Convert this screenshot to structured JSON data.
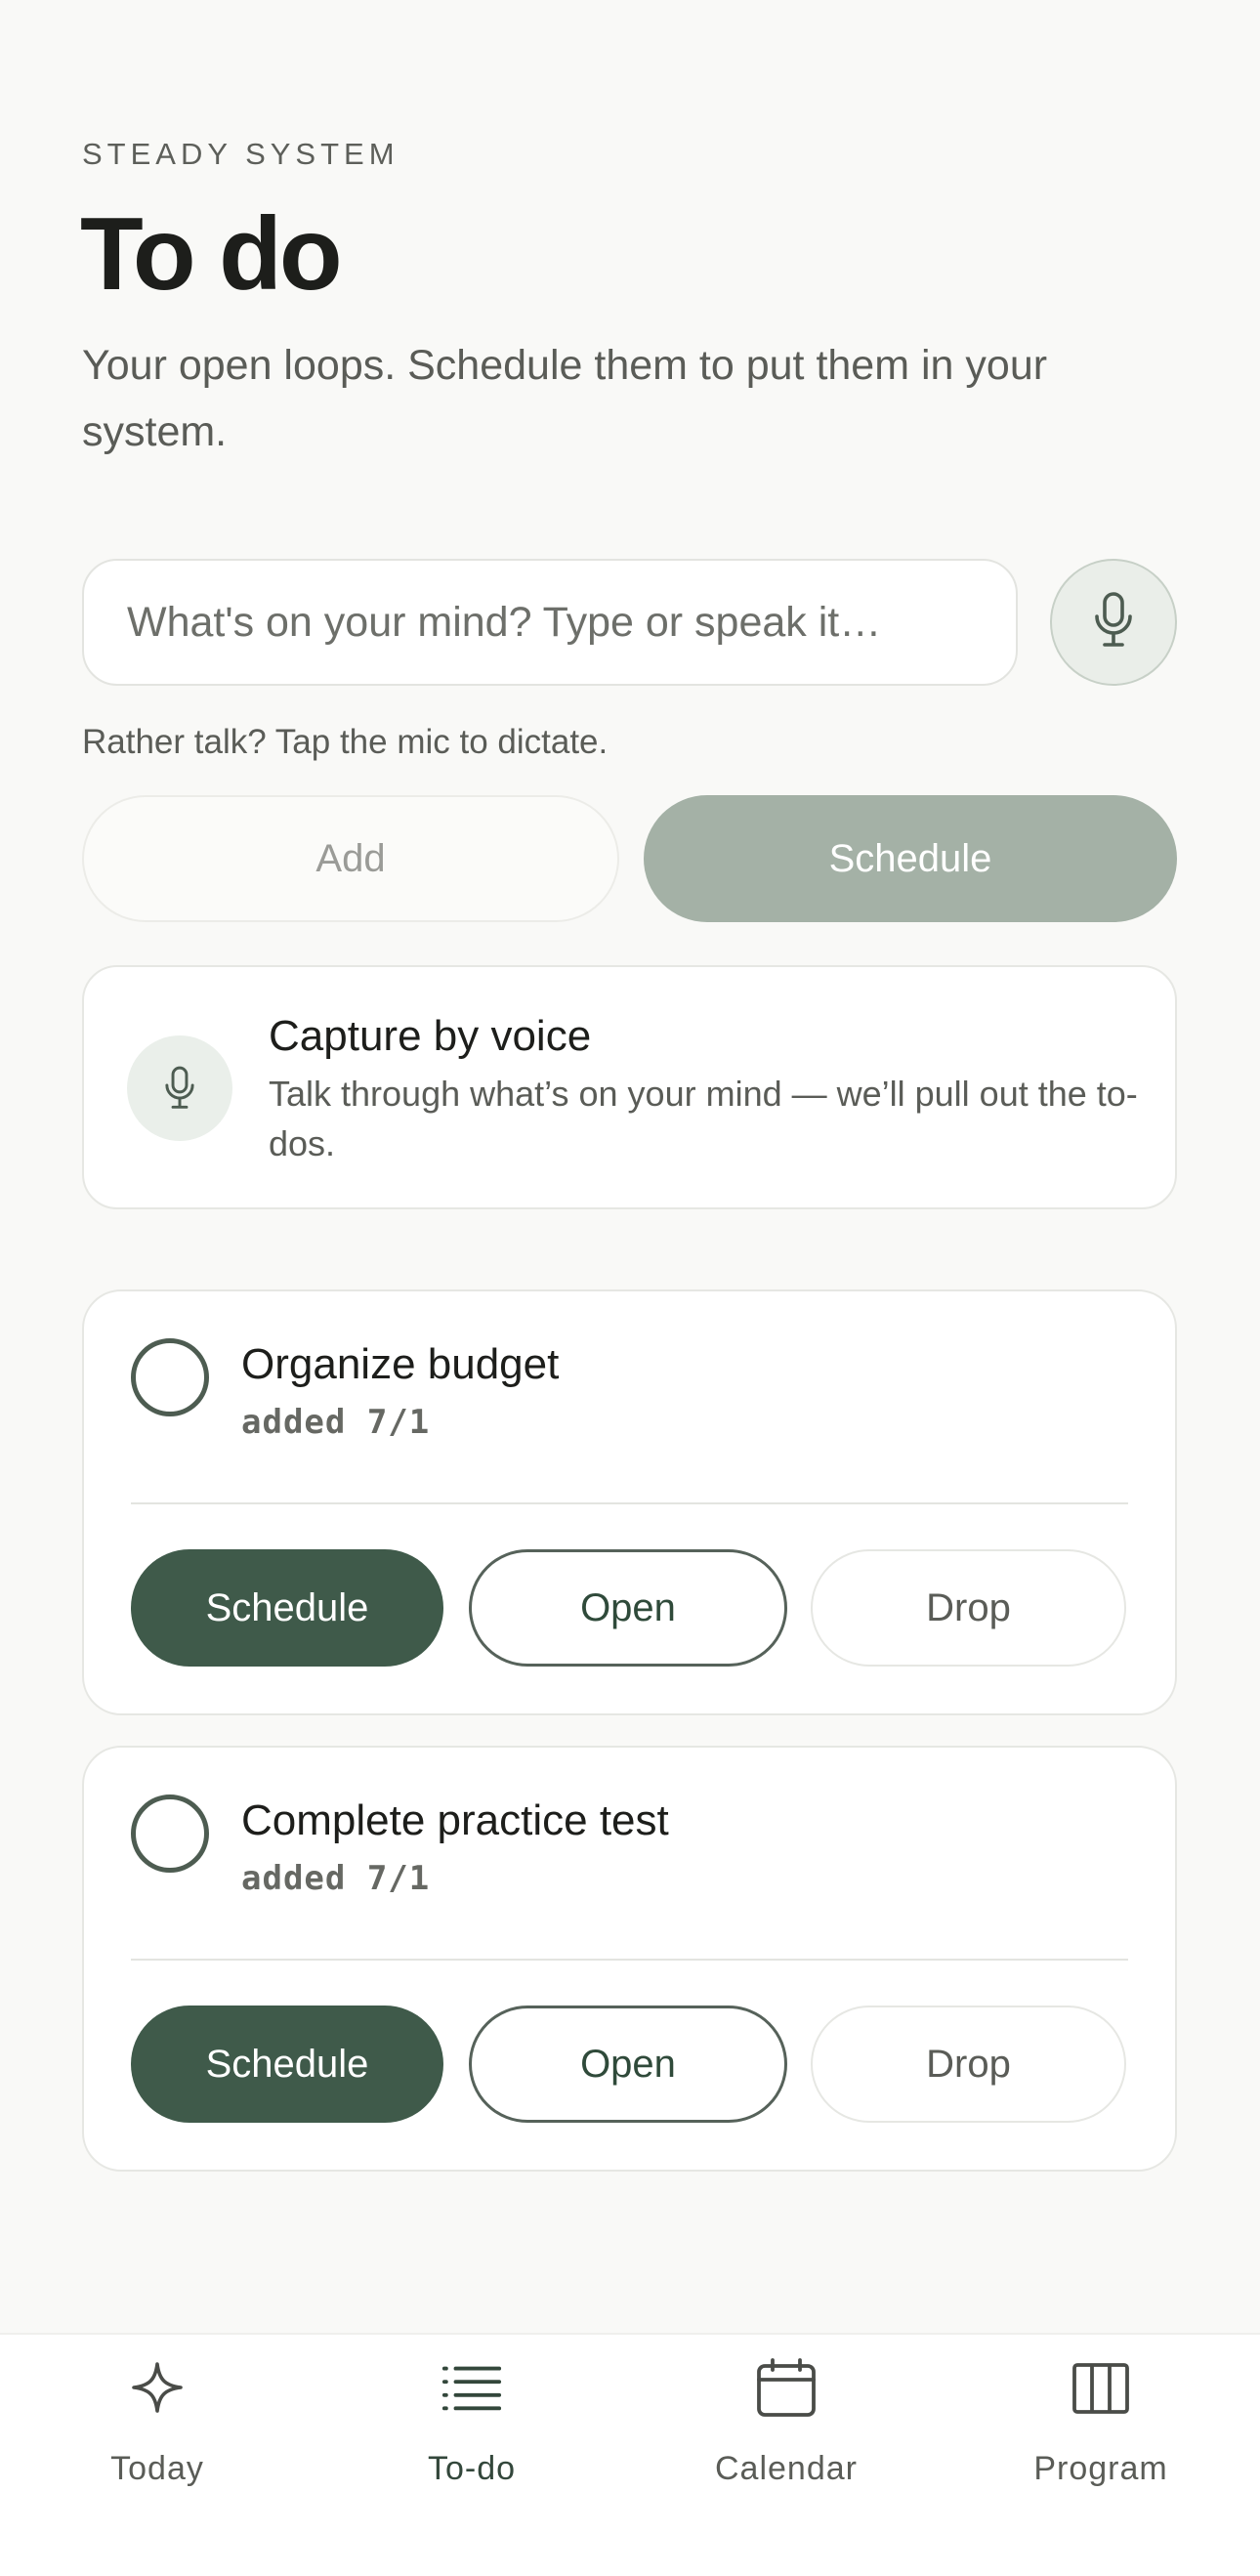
{
  "header": {
    "eyebrow": "STEADY SYSTEM",
    "title": "To do",
    "subtitle": "Your open loops. Schedule them to put them in your system."
  },
  "capture": {
    "placeholder": "What's on your mind? Type or speak it…",
    "value": "",
    "hint": "Rather talk? Tap the mic to dictate.",
    "add_label": "Add",
    "schedule_label": "Schedule"
  },
  "voice_card": {
    "title": "Capture by voice",
    "description": "Talk through what’s on your mind — we’ll pull out the to-dos."
  },
  "tasks": [
    {
      "title": "Organize budget",
      "added": "added 7/1",
      "schedule": "Schedule",
      "open": "Open",
      "drop": "Drop"
    },
    {
      "title": "Complete practice test",
      "added": "added 7/1",
      "schedule": "Schedule",
      "open": "Open",
      "drop": "Drop"
    }
  ],
  "tabbar": [
    {
      "label": "Today",
      "icon": "sparkle-icon",
      "active": false
    },
    {
      "label": "To-do",
      "icon": "list-icon",
      "active": true
    },
    {
      "label": "Calendar",
      "icon": "calendar-icon",
      "active": false
    },
    {
      "label": "Program",
      "icon": "book-icon",
      "active": false
    }
  ],
  "colors": {
    "background": "#f9f9f7",
    "accent": "#3f5a4a",
    "accent_muted": "#a4b1a6",
    "mic_bg": "#eaeee9"
  }
}
